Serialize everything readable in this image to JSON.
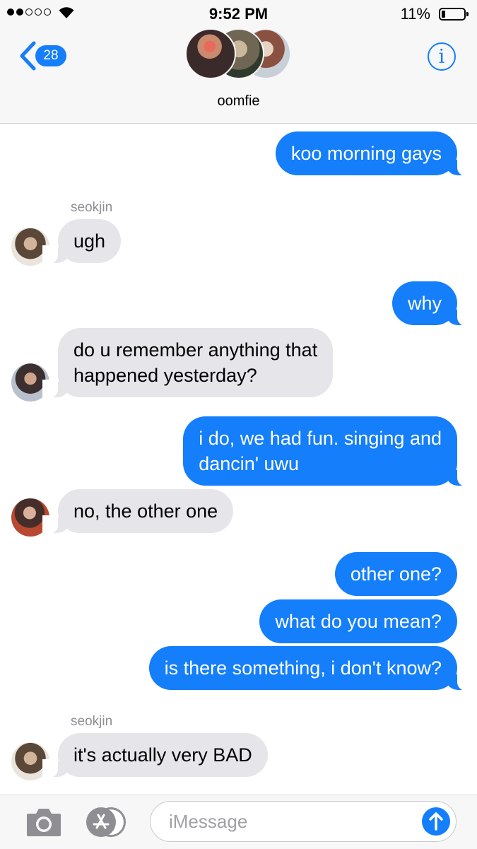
{
  "status": {
    "time": "9:52 PM",
    "battery_percent": "11%",
    "signal_bars_filled": 2,
    "signal_bars_total": 5,
    "battery_level": 0.11
  },
  "nav": {
    "back_count": "28",
    "conversation_name": "oomfie",
    "info_label": "i"
  },
  "messages": [
    {
      "sender": "me",
      "text": "koo morning gays"
    },
    {
      "sender_label": "seokjin",
      "text": "ugh"
    },
    {
      "sender": "me",
      "text": "why"
    },
    {
      "text_line1": "do u remember anything that",
      "text_line2": "happened yesterday?"
    },
    {
      "sender": "me",
      "text_line1": "i do, we had fun. singing and",
      "text_line2": "dancin' uwu"
    },
    {
      "text": "no, the other one"
    },
    {
      "sender": "me",
      "text": "other one?"
    },
    {
      "sender": "me",
      "text": "what do you mean?"
    },
    {
      "sender": "me",
      "text": "is there something, i don't know?"
    },
    {
      "sender_label": "seokjin",
      "text": "it's actually very BAD"
    }
  ],
  "composer": {
    "placeholder": "iMessage"
  },
  "colors": {
    "accent": "#147efb",
    "incoming_bubble": "#e5e5ea",
    "outgoing_bubble": "#147efb",
    "sender_label": "#8e8e93"
  }
}
